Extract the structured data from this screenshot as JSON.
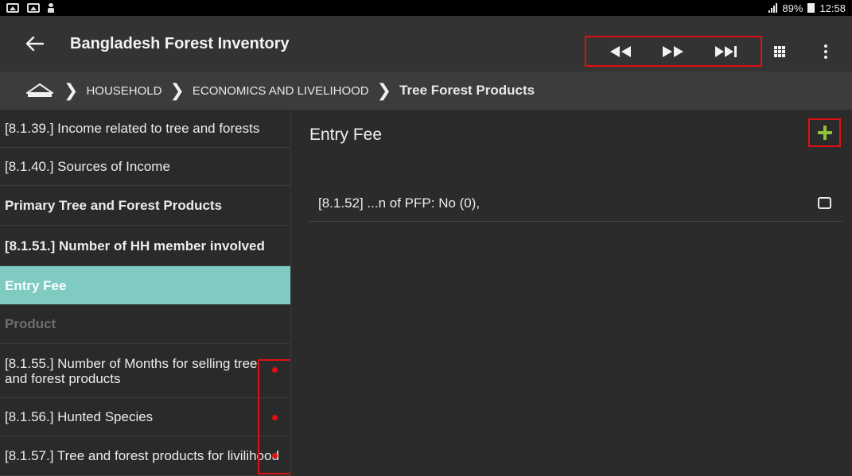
{
  "status_bar": {
    "icons": [
      "image-icon",
      "gallery-icon",
      "person-icon"
    ],
    "battery": "89%",
    "time": "12:58"
  },
  "app_bar": {
    "title": "Bangladesh Forest Inventory",
    "icons": [
      "back-arrow-icon",
      "rewind-icon",
      "fast-forward-icon",
      "skip-to-end-icon",
      "grid-icon",
      "more-vert-icon"
    ]
  },
  "breadcrumb": {
    "items": [
      "HOUSEHOLD",
      "ECONOMICS AND LIVELIHOOD",
      "Tree Forest Products"
    ]
  },
  "sidebar": {
    "items": [
      {
        "label": "[8.1.39.] Income related to tree and forests",
        "style": "normal"
      },
      {
        "label": "[8.1.40.] Sources of Income",
        "style": "normal"
      },
      {
        "label": "Primary Tree and Forest Products",
        "style": "bold"
      },
      {
        "label": "[8.1.51.] Number of HH member involved",
        "style": "bold"
      },
      {
        "label": "Entry Fee",
        "style": "selected"
      },
      {
        "label": "Product",
        "style": "disabled"
      },
      {
        "label": "[8.1.55.] Number of Months for selling tree and forest products",
        "style": "normal"
      },
      {
        "label": "[8.1.56.] Hunted Species",
        "style": "normal"
      },
      {
        "label": "[8.1.57.] Tree and forest products for livilihood",
        "style": "normal"
      }
    ]
  },
  "main": {
    "section_title": "Entry Fee",
    "entries": [
      {
        "label": "[8.1.52] ...n of PFP: No (0),",
        "checked": false
      }
    ]
  },
  "colors": {
    "selected_bg": "#7fcac1",
    "highlight_box": "#e01010",
    "add_icon": "#8fc43a",
    "app_bar_bg": "#333333"
  }
}
